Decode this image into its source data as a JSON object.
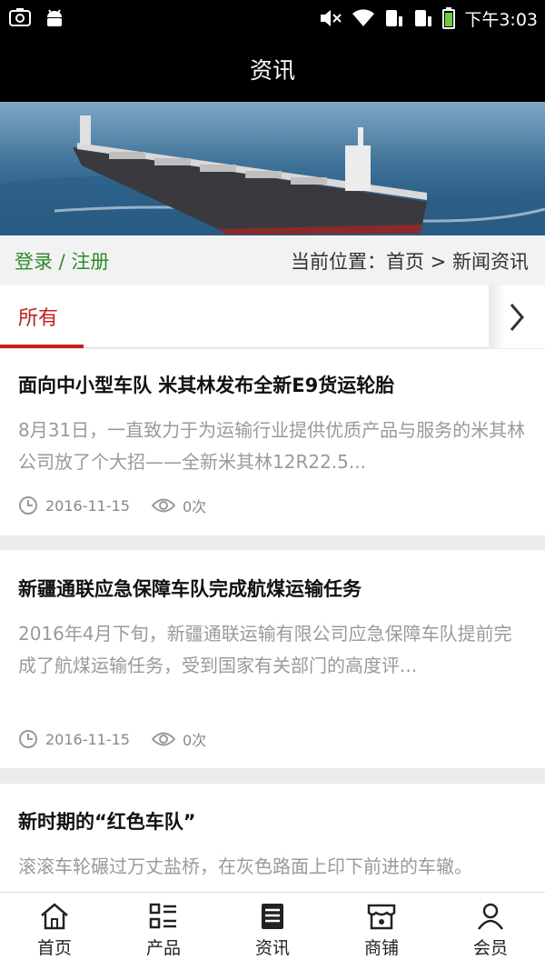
{
  "status_bar": {
    "time": "下午3:03"
  },
  "title_bar": {
    "title": "资讯"
  },
  "location_bar": {
    "login_label": "登录 / 注册",
    "breadcrumb": "当前位置：首页 > 新闻资讯"
  },
  "tabs": {
    "active_label": "所有"
  },
  "articles": [
    {
      "title": "面向中小型车队 米其林发布全新E9货运轮胎",
      "summary": "8月31日，一直致力于为运输行业提供优质产品与服务的米其林公司放了个大招——全新米其林12R22.5...",
      "date": "2016-11-15",
      "views": "0次"
    },
    {
      "title": "新疆通联应急保障车队完成航煤运输任务",
      "summary": "2016年4月下旬，新疆通联运输有限公司应急保障车队提前完成了航煤运输任务，受到国家有关部门的高度评...",
      "date": "2016-11-15",
      "views": "0次"
    },
    {
      "title": "新时期的“红色车队”",
      "summary": "滚滚车轮碾过万丈盐桥，在灰色路面上印下前进的车辙。"
    }
  ],
  "bottom_nav": [
    {
      "label": "首页",
      "icon": "home-icon"
    },
    {
      "label": "产品",
      "icon": "product-list-icon"
    },
    {
      "label": "资讯",
      "icon": "news-icon"
    },
    {
      "label": "商铺",
      "icon": "store-icon"
    },
    {
      "label": "会员",
      "icon": "member-icon"
    }
  ]
}
